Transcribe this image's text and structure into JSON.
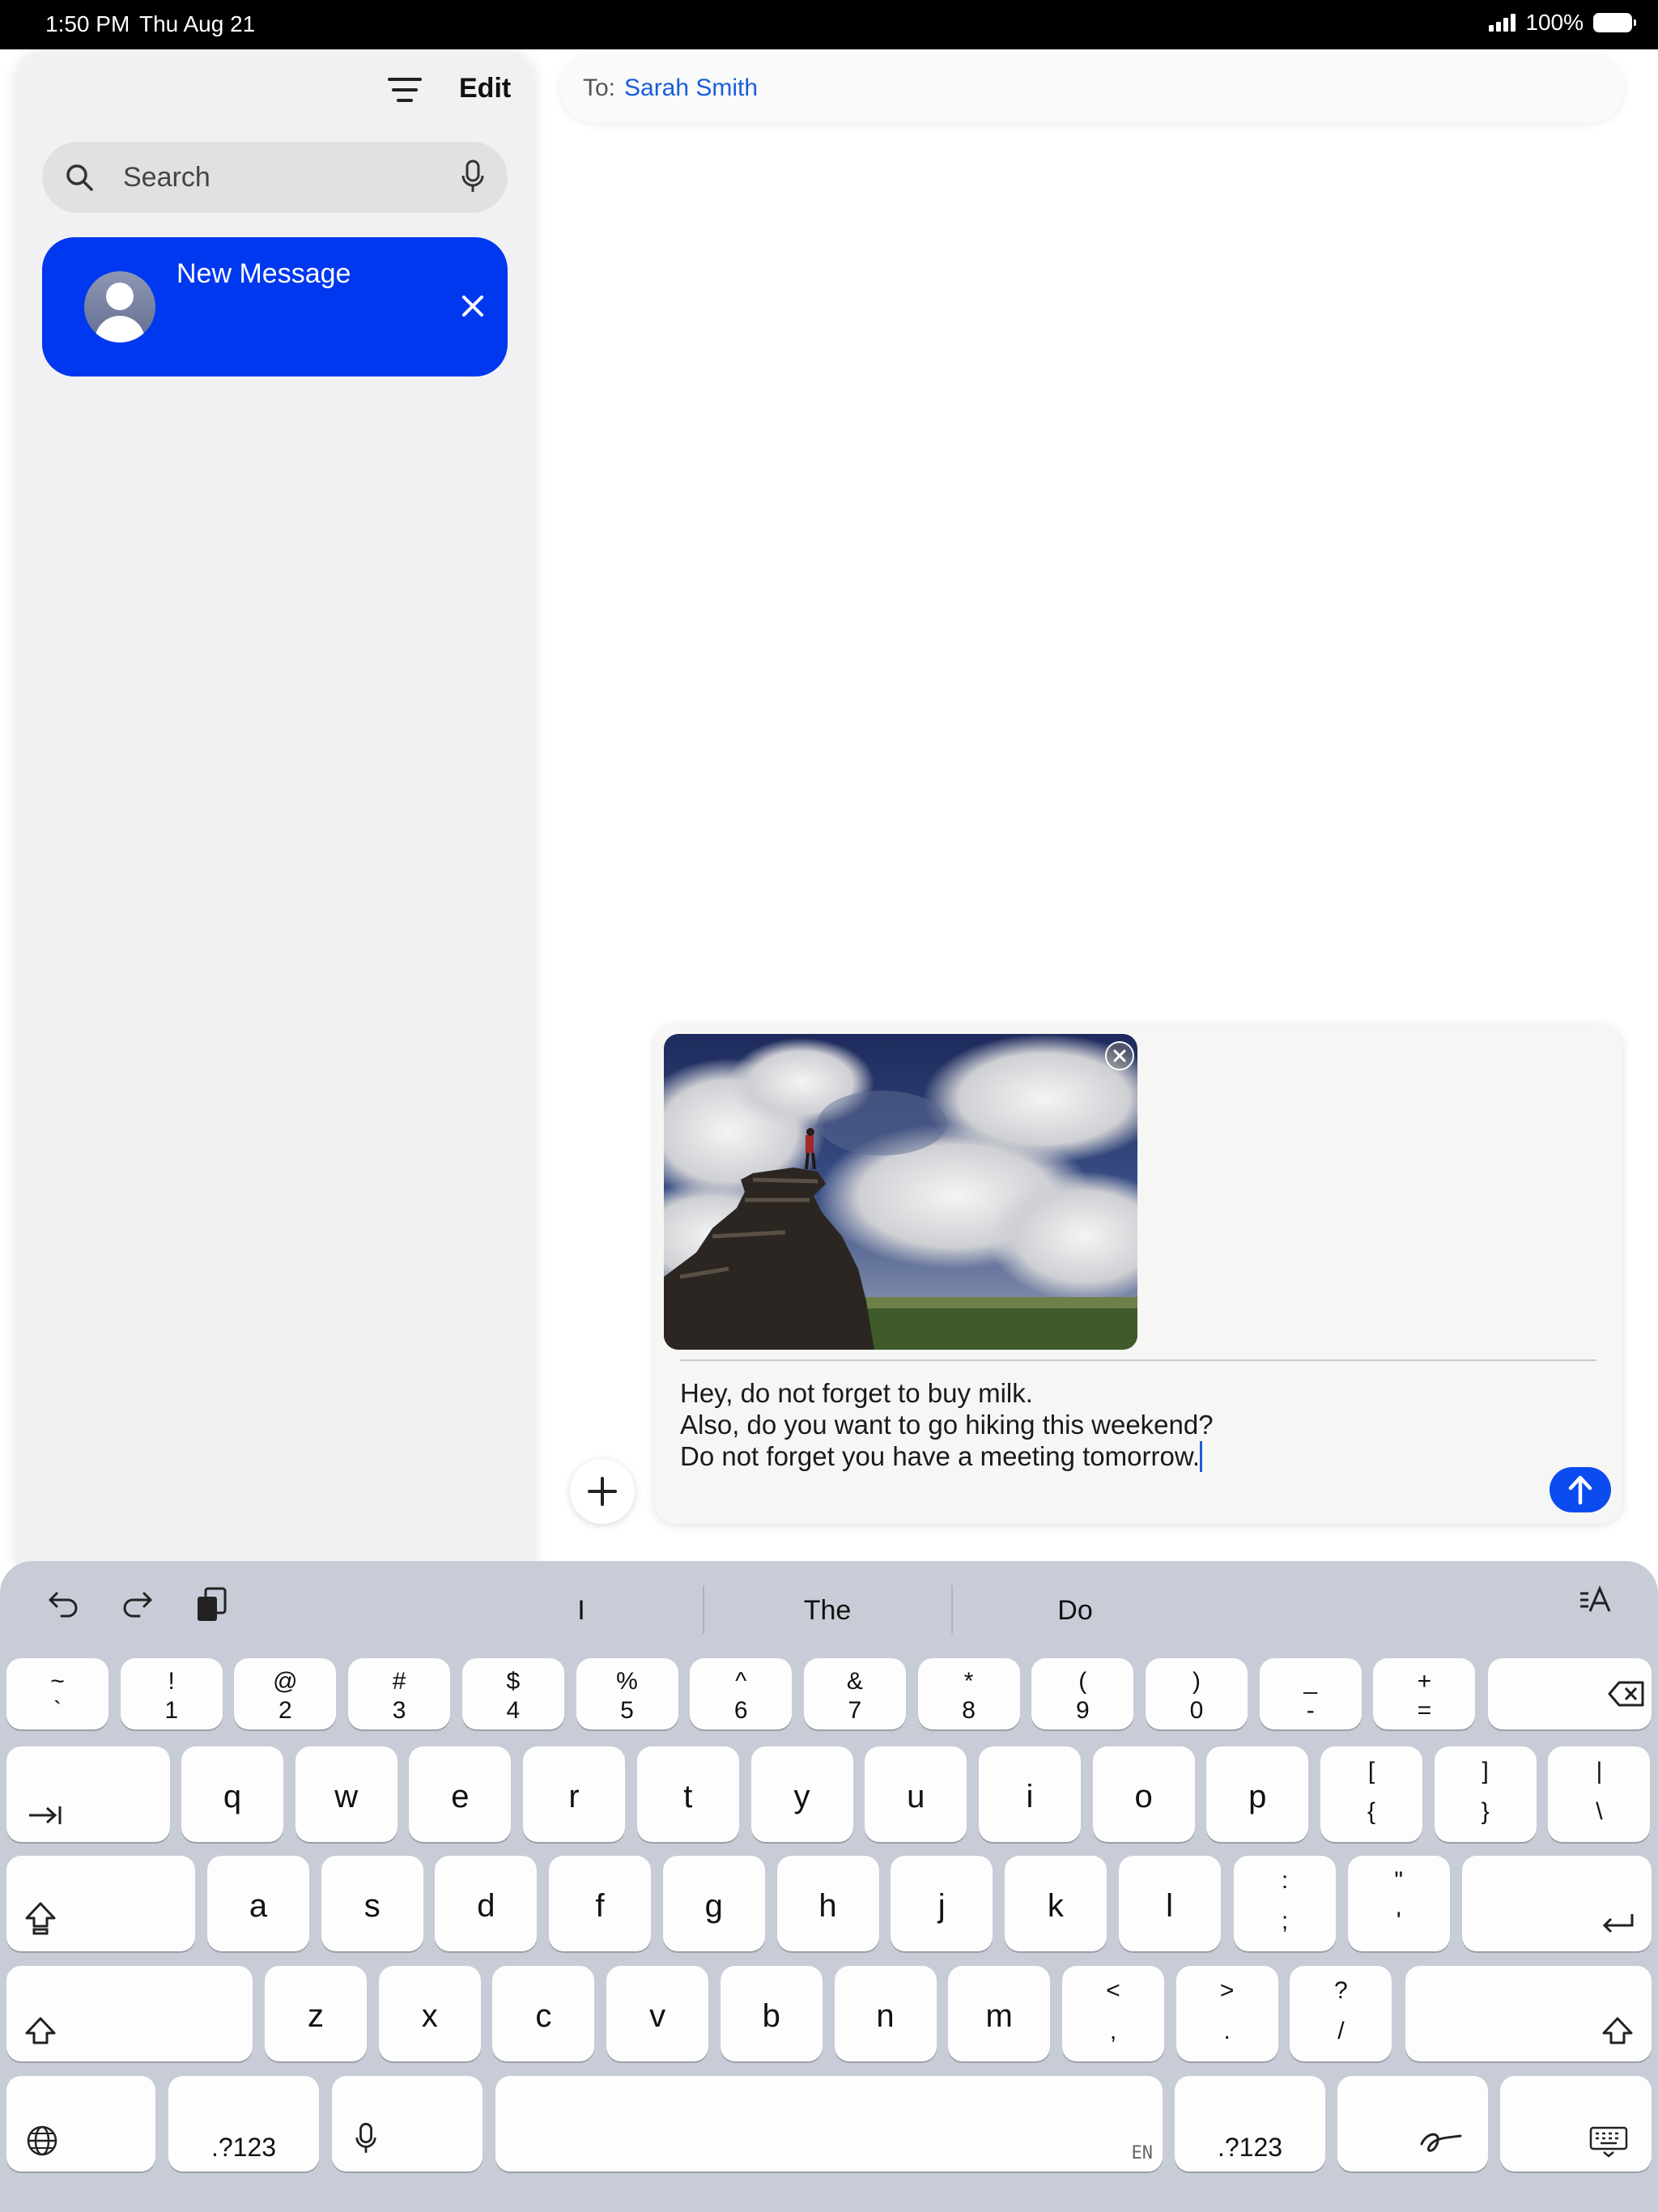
{
  "status_bar": {
    "time": "1:50 PM",
    "date": "Thu Aug 21",
    "battery": "100%"
  },
  "sidebar": {
    "edit_label": "Edit",
    "search_placeholder": "Search",
    "new_message": {
      "title": "New Message"
    }
  },
  "compose": {
    "to_label": "To:",
    "recipient": "Sarah Smith",
    "message_lines": [
      "Hey, do not forget to buy milk.",
      "Also, do you want to go hiking this weekend?",
      "Do not forget you have a meeting tomorrow."
    ]
  },
  "keyboard": {
    "suggestions": [
      "I",
      "The",
      "Do"
    ],
    "number_row": [
      {
        "top": "~",
        "bot": "`"
      },
      {
        "top": "!",
        "bot": "1"
      },
      {
        "top": "@",
        "bot": "2"
      },
      {
        "top": "#",
        "bot": "3"
      },
      {
        "top": "$",
        "bot": "4"
      },
      {
        "top": "%",
        "bot": "5"
      },
      {
        "top": "^",
        "bot": "6"
      },
      {
        "top": "&",
        "bot": "7"
      },
      {
        "top": "*",
        "bot": "8"
      },
      {
        "top": "(",
        "bot": "9"
      },
      {
        "top": ")",
        "bot": "0"
      },
      {
        "top": "_",
        "bot": "-"
      },
      {
        "top": "+",
        "bot": "="
      }
    ],
    "row_q": [
      "q",
      "w",
      "e",
      "r",
      "t",
      "y",
      "u",
      "i",
      "o",
      "p"
    ],
    "row_q_symbols": [
      {
        "top": "[",
        "bot": "{"
      },
      {
        "top": "]",
        "bot": "}"
      },
      {
        "top": "|",
        "bot": "\\"
      }
    ],
    "row_a": [
      "a",
      "s",
      "d",
      "f",
      "g",
      "h",
      "j",
      "k",
      "l"
    ],
    "row_a_symbols": [
      {
        "top": ":",
        "bot": ";"
      },
      {
        "top": "\"",
        "bot": "'"
      }
    ],
    "row_z": [
      "z",
      "x",
      "c",
      "v",
      "b",
      "n",
      "m"
    ],
    "row_z_symbols": [
      {
        "top": "<",
        "bot": ","
      },
      {
        "top": ">",
        "bot": "."
      },
      {
        "top": "?",
        "bot": "/"
      }
    ],
    "numbers_label": ".?123",
    "space_lang": "EN"
  }
}
